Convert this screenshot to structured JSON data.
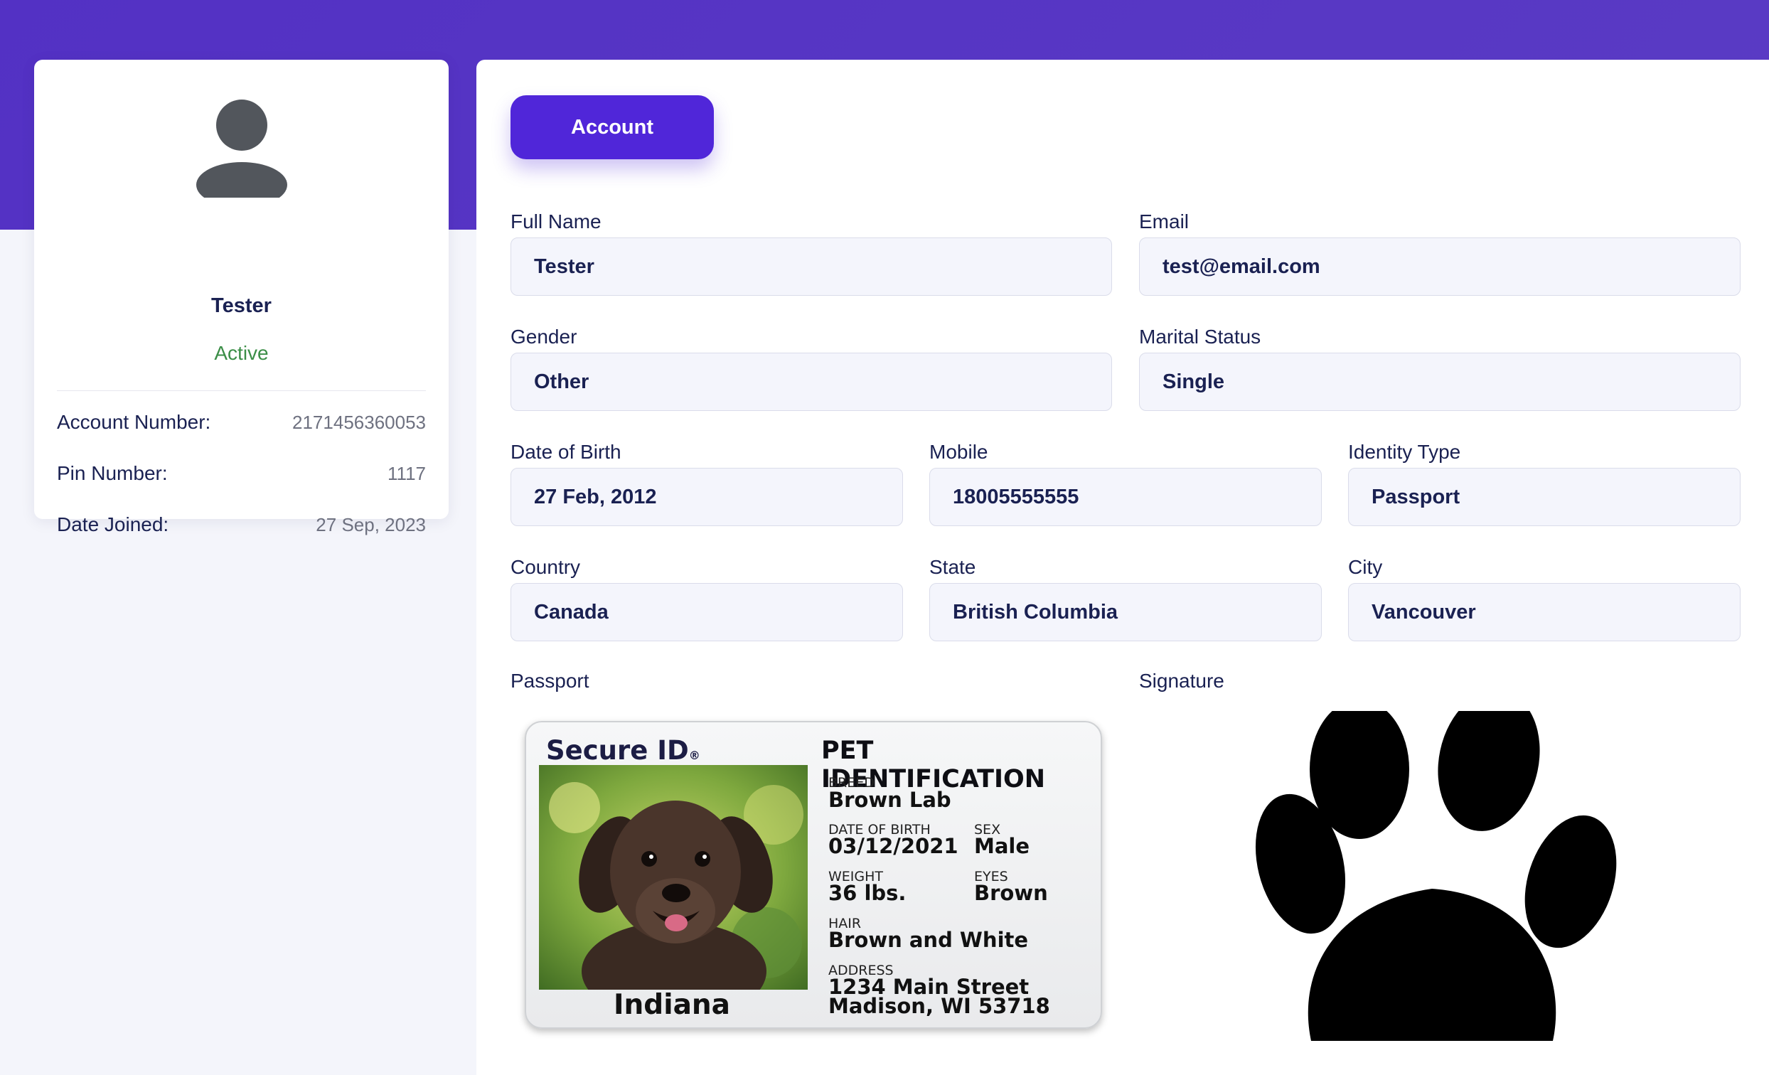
{
  "profile": {
    "name": "Tester",
    "status": "Active",
    "account_number_label": "Account Number:",
    "account_number": "2171456360053",
    "pin_label": "Pin Number:",
    "pin": "1117",
    "date_joined_label": "Date Joined:",
    "date_joined": "27 Sep, 2023",
    "avatar_icon": "user-icon"
  },
  "tabs": {
    "account_label": "Account"
  },
  "form": {
    "full_name": {
      "label": "Full Name",
      "value": "Tester"
    },
    "email": {
      "label": "Email",
      "value": "test@email.com"
    },
    "gender": {
      "label": "Gender",
      "value": "Other"
    },
    "marital_status": {
      "label": "Marital Status",
      "value": "Single"
    },
    "dob": {
      "label": "Date of Birth",
      "value": "27 Feb, 2012"
    },
    "mobile": {
      "label": "Mobile",
      "value": "18005555555"
    },
    "identity_type": {
      "label": "Identity Type",
      "value": "Passport"
    },
    "country": {
      "label": "Country",
      "value": "Canada"
    },
    "state": {
      "label": "State",
      "value": "British Columbia"
    },
    "city": {
      "label": "City",
      "value": "Vancouver"
    }
  },
  "documents": {
    "passport_label": "Passport",
    "signature_label": "Signature"
  },
  "id_card": {
    "brand": "Secure ID",
    "brand_mark": "®",
    "title": "PET IDENTIFICATION",
    "breed_label": "BREED",
    "breed": "Brown Lab",
    "dob_label": "DATE OF BIRTH",
    "dob": "03/12/2021",
    "sex_label": "SEX",
    "sex": "Male",
    "weight_label": "WEIGHT",
    "weight": "36 lbs.",
    "eyes_label": "EYES",
    "eyes": "Brown",
    "hair_label": "HAIR",
    "hair": "Brown and White",
    "address_label": "ADDRESS",
    "address_line1": "1234 Main Street",
    "address_line2": "Madison, WI 53718",
    "state_name": "Indiana"
  },
  "colors": {
    "brand_purple": "#5026d9",
    "header_band": "#5331c4",
    "active_green": "#3b8e47"
  }
}
